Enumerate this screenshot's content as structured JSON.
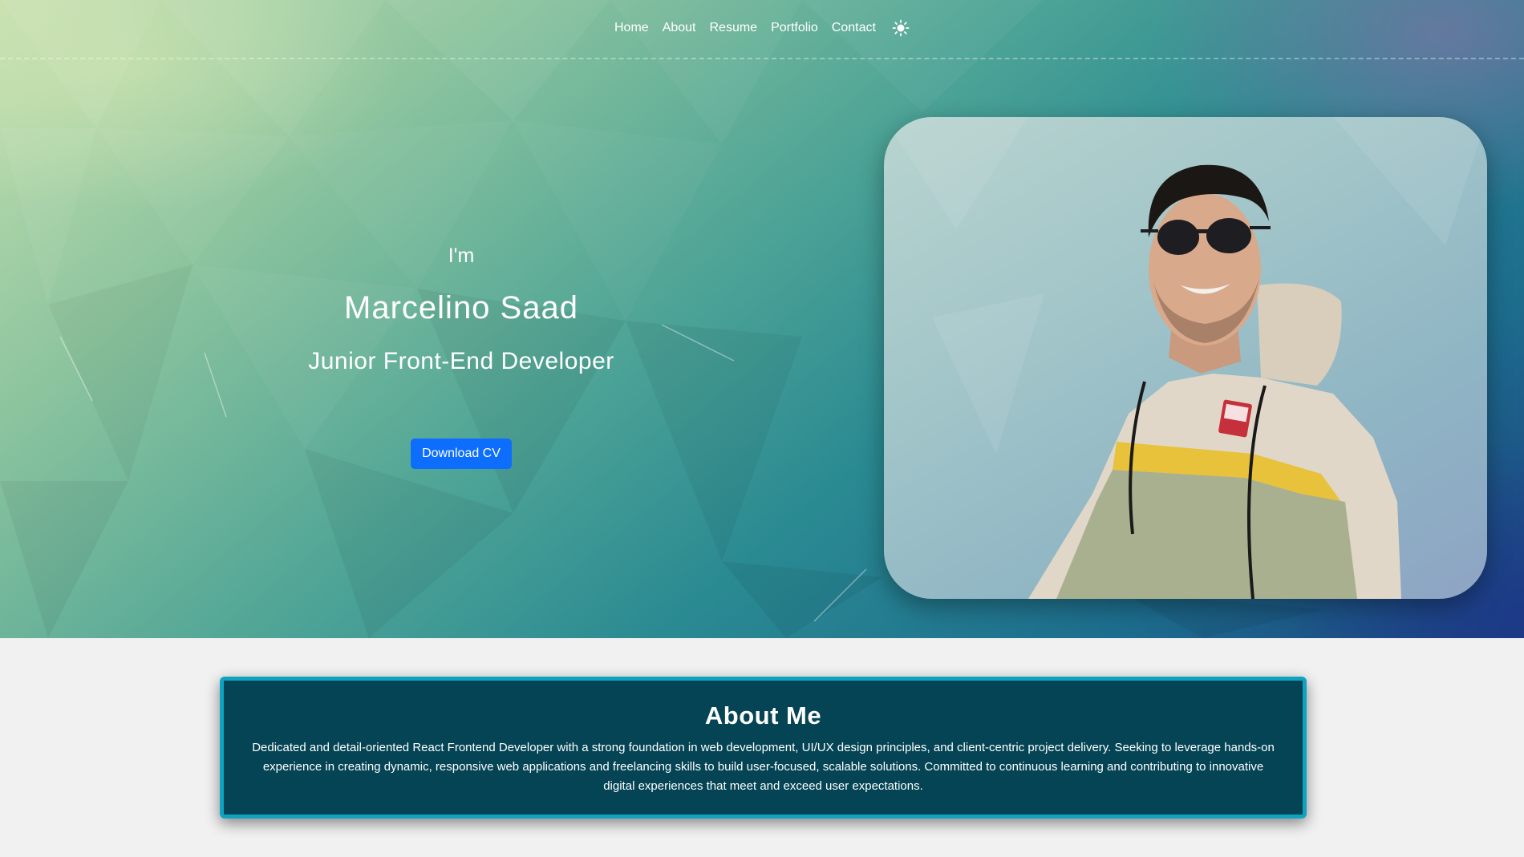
{
  "nav": {
    "links": [
      "Home",
      "About",
      "Resume",
      "Portfolio",
      "Contact"
    ],
    "theme_toggle_icon": "sun-icon"
  },
  "hero": {
    "greeting": "I'm",
    "name": "Marcelino Saad",
    "role": "Junior Front-End Developer",
    "cta_label": "Download CV",
    "photo_description": "profile-photo"
  },
  "about": {
    "title": "About Me",
    "text": "Dedicated and detail-oriented React Frontend Developer with a strong foundation in web development, UI/UX design principles, and client-centric project delivery. Seeking to leverage hands-on experience in creating dynamic, responsive web applications and freelancing skills to build user-focused, scalable solutions. Committed to continuous learning and contributing to innovative digital experiences that meet and exceed user expectations."
  },
  "colors": {
    "primary_button": "#0d6efd",
    "about_bg": "#044454",
    "about_border": "#0fa3c1",
    "page_bg": "#f1f1f1"
  }
}
